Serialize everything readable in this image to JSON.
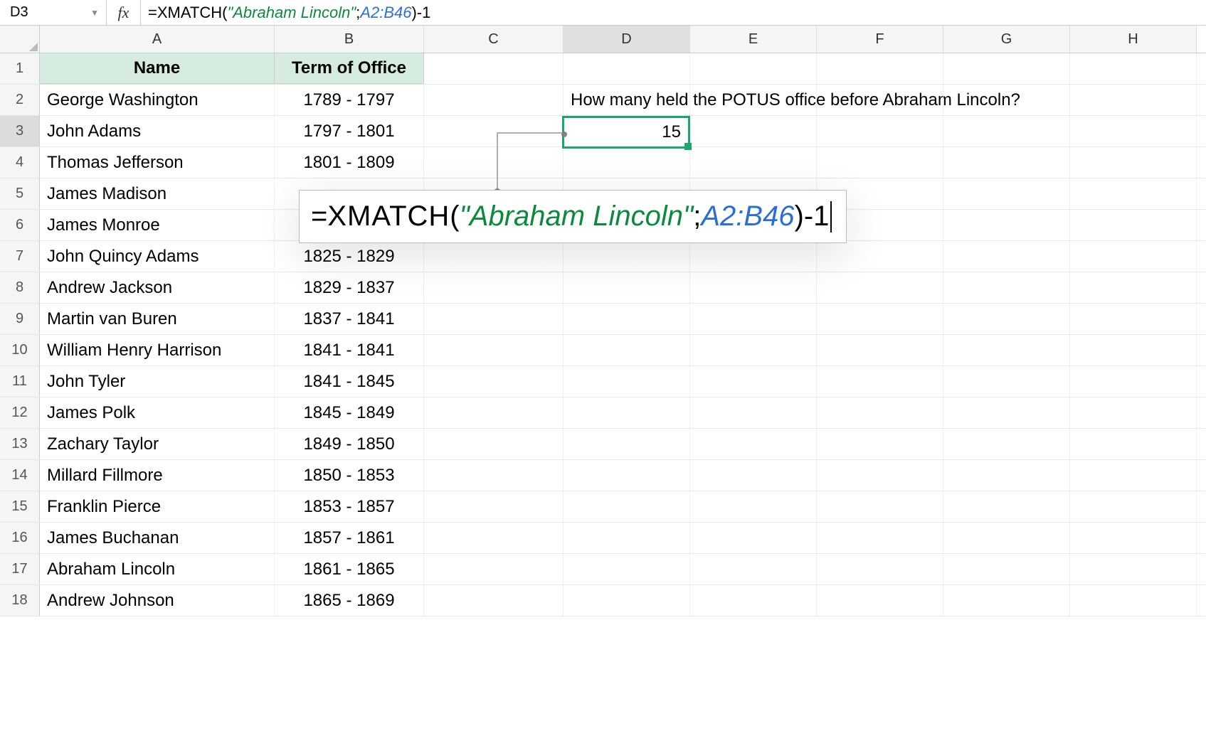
{
  "namebox": {
    "cell_ref": "D3",
    "fx_label": "fx"
  },
  "formula_bar": {
    "prefix": "=",
    "func": "XMATCH",
    "open": "(",
    "arg_str": "\"Abraham Lincoln\"",
    "sep": ";",
    "arg_range": "A2:B46",
    "close": ")",
    "suffix": "-1"
  },
  "columns": [
    "A",
    "B",
    "C",
    "D",
    "E",
    "F",
    "G",
    "H"
  ],
  "headers": {
    "name": "Name",
    "term": "Term of Office"
  },
  "rows": [
    {
      "n": 1
    },
    {
      "n": 2,
      "name": "George Washington",
      "term": "1789 - 1797"
    },
    {
      "n": 3,
      "name": "John Adams",
      "term": "1797 - 1801"
    },
    {
      "n": 4,
      "name": "Thomas Jefferson",
      "term": "1801 - 1809"
    },
    {
      "n": 5,
      "name": "James Madison",
      "term": ""
    },
    {
      "n": 6,
      "name": "James Monroe",
      "term": ""
    },
    {
      "n": 7,
      "name": "John Quincy Adams",
      "term": "1825 - 1829"
    },
    {
      "n": 8,
      "name": "Andrew Jackson",
      "term": "1829 - 1837"
    },
    {
      "n": 9,
      "name": "Martin van Buren",
      "term": "1837 - 1841"
    },
    {
      "n": 10,
      "name": "William Henry Harrison",
      "term": "1841 - 1841"
    },
    {
      "n": 11,
      "name": "John Tyler",
      "term": "1841 - 1845"
    },
    {
      "n": 12,
      "name": "James Polk",
      "term": "1845 - 1849"
    },
    {
      "n": 13,
      "name": "Zachary Taylor",
      "term": "1849 - 1850"
    },
    {
      "n": 14,
      "name": "Millard Fillmore",
      "term": "1850 - 1853"
    },
    {
      "n": 15,
      "name": "Franklin Pierce",
      "term": "1853 - 1857"
    },
    {
      "n": 16,
      "name": "James Buchanan",
      "term": "1857 - 1861"
    },
    {
      "n": 17,
      "name": "Abraham Lincoln",
      "term": "1861 - 1865"
    },
    {
      "n": 18,
      "name": "Andrew Johnson",
      "term": "1865 - 1869"
    }
  ],
  "question": "How many held the POTUS office before Abraham Lincoln?",
  "result": "15",
  "tooltip": {
    "eq": "=",
    "fn": "XMATCH",
    "open": "(",
    "str": "\"Abraham Lincoln\"",
    "sep": ";",
    "rng": "A2:B46",
    "close": ")",
    "tail": "-1"
  }
}
